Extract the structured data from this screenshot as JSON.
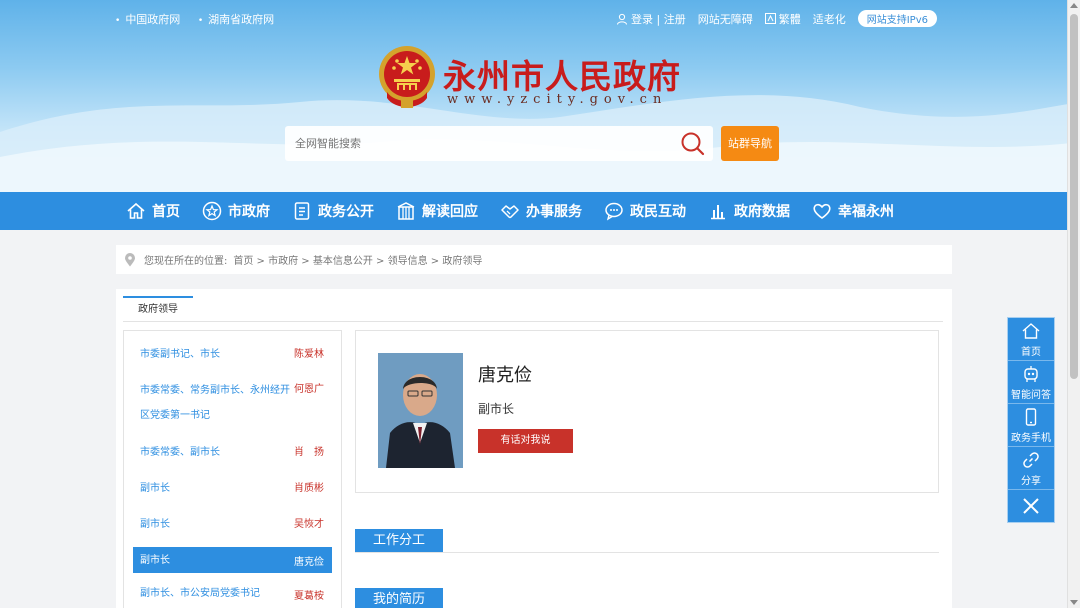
{
  "topbar": {
    "links": [
      "中国政府网",
      "湖南省政府网"
    ],
    "login": "登录 | 注册",
    "accessibility": "网站无障碍",
    "traditional": "繁體",
    "elderly": "适老化",
    "ipv6": "网站支持IPv6"
  },
  "site": {
    "title": "永州市人民政府",
    "url": "www.yzcity.gov.cn"
  },
  "search": {
    "placeholder": "全网智能搜索",
    "site_nav_label": "站群导航"
  },
  "nav": [
    {
      "label": "首页",
      "icon": "home-icon"
    },
    {
      "label": "市政府",
      "icon": "star-badge-icon"
    },
    {
      "label": "政务公开",
      "icon": "document-icon"
    },
    {
      "label": "解读回应",
      "icon": "building-icon"
    },
    {
      "label": "办事服务",
      "icon": "handshake-icon"
    },
    {
      "label": "政民互动",
      "icon": "chat-icon"
    },
    {
      "label": "政府数据",
      "icon": "bar-chart-icon"
    },
    {
      "label": "幸福永州",
      "icon": "heart-icon"
    }
  ],
  "breadcrumb": {
    "prefix": "您现在所在的位置:",
    "path": "首页 > 市政府 > 基本信息公开 > 领导信息 > 政府领导"
  },
  "sidebar": {
    "tab": "政府领导",
    "items": [
      {
        "post": "市委副书记、市长",
        "name": "陈爱林"
      },
      {
        "post": "市委常委、常务副市长、永州经开区党委第一书记",
        "name": "何恩广"
      },
      {
        "post": "市委常委、副市长",
        "name": "肖　扬"
      },
      {
        "post": "副市长",
        "name": "肖质彬"
      },
      {
        "post": "副市长",
        "name": "吴恢才"
      },
      {
        "post": "副市长",
        "name": "唐克俭"
      },
      {
        "post": "副市长、市公安局党委书记",
        "name": "夏葛桉"
      }
    ],
    "active_index": 5
  },
  "profile": {
    "name": "唐克俭",
    "title": "副市长",
    "button": "有话对我说"
  },
  "sections": {
    "work": "工作分工",
    "resume": "我的简历"
  },
  "tools": [
    {
      "label": "首页",
      "icon": "home-icon"
    },
    {
      "label": "智能问答",
      "icon": "robot-icon"
    },
    {
      "label": "政务手机",
      "icon": "mobile-icon"
    },
    {
      "label": "分享",
      "icon": "link-icon"
    }
  ],
  "colors": {
    "primary": "#2d8ee0",
    "accent_red": "#c8322a",
    "orange": "#f58a13"
  }
}
